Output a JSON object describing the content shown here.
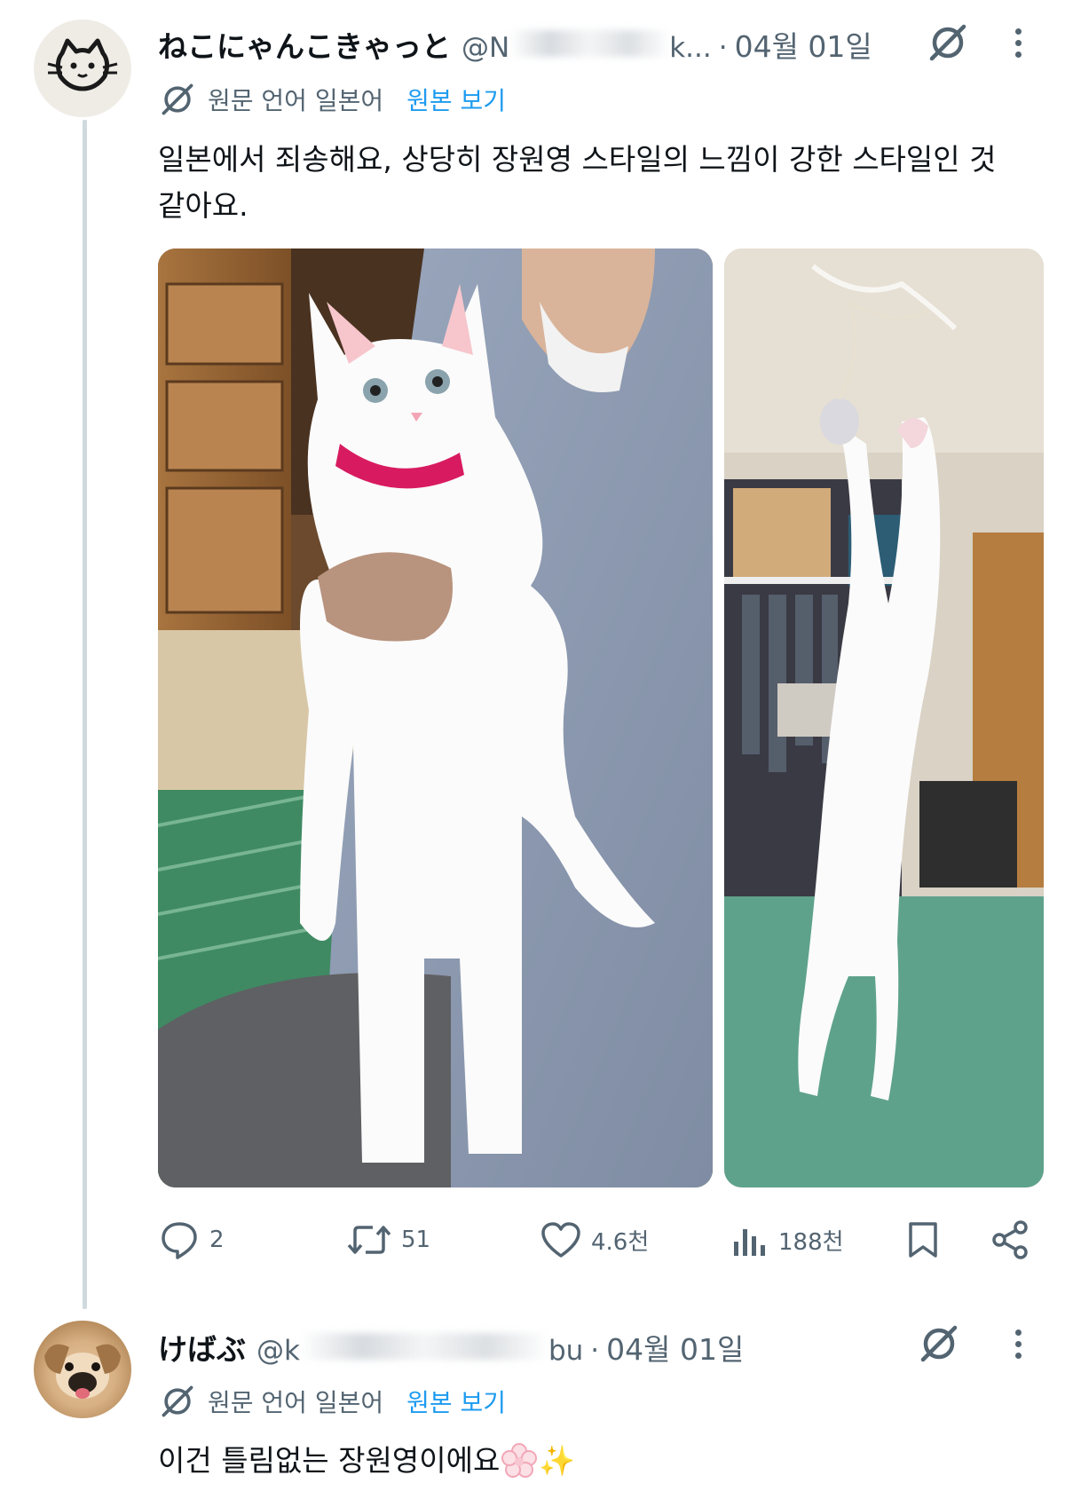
{
  "tweets": [
    {
      "display_name": "ねこにゃんこきゃっと",
      "handle": "@N",
      "handle_tail": "k...",
      "separator": "·",
      "date": "04월 01일",
      "translate": {
        "label": "원문 언어 일본어",
        "link": "원본 보기"
      },
      "text_line1": "일본에서 죄송해요, 상당히 장원영 스타일의 느낌이 강한 스타일인 것",
      "text_line2": "같아요.",
      "metrics": {
        "replies": "2",
        "reposts": "51",
        "likes": "4.6천",
        "views": "188천"
      }
    },
    {
      "display_name": "けばぶ",
      "handle": "@k",
      "handle_tail": "bu",
      "separator": "·",
      "date": "04월 01일",
      "translate": {
        "label": "원문 언어 일본어",
        "link": "원본 보기"
      },
      "text": "이건 틀림없는 장원영이에요",
      "emoji": "✨"
    }
  ],
  "icons": [
    "grok-icon",
    "more-icon",
    "translate-icon",
    "reply-icon",
    "repost-icon",
    "like-icon",
    "views-icon",
    "bookmark-icon",
    "share-icon"
  ],
  "colors": {
    "link": "#1d9bf0",
    "secondary": "#536471",
    "text": "#0f1419",
    "thread_line": "#cfd9de"
  }
}
